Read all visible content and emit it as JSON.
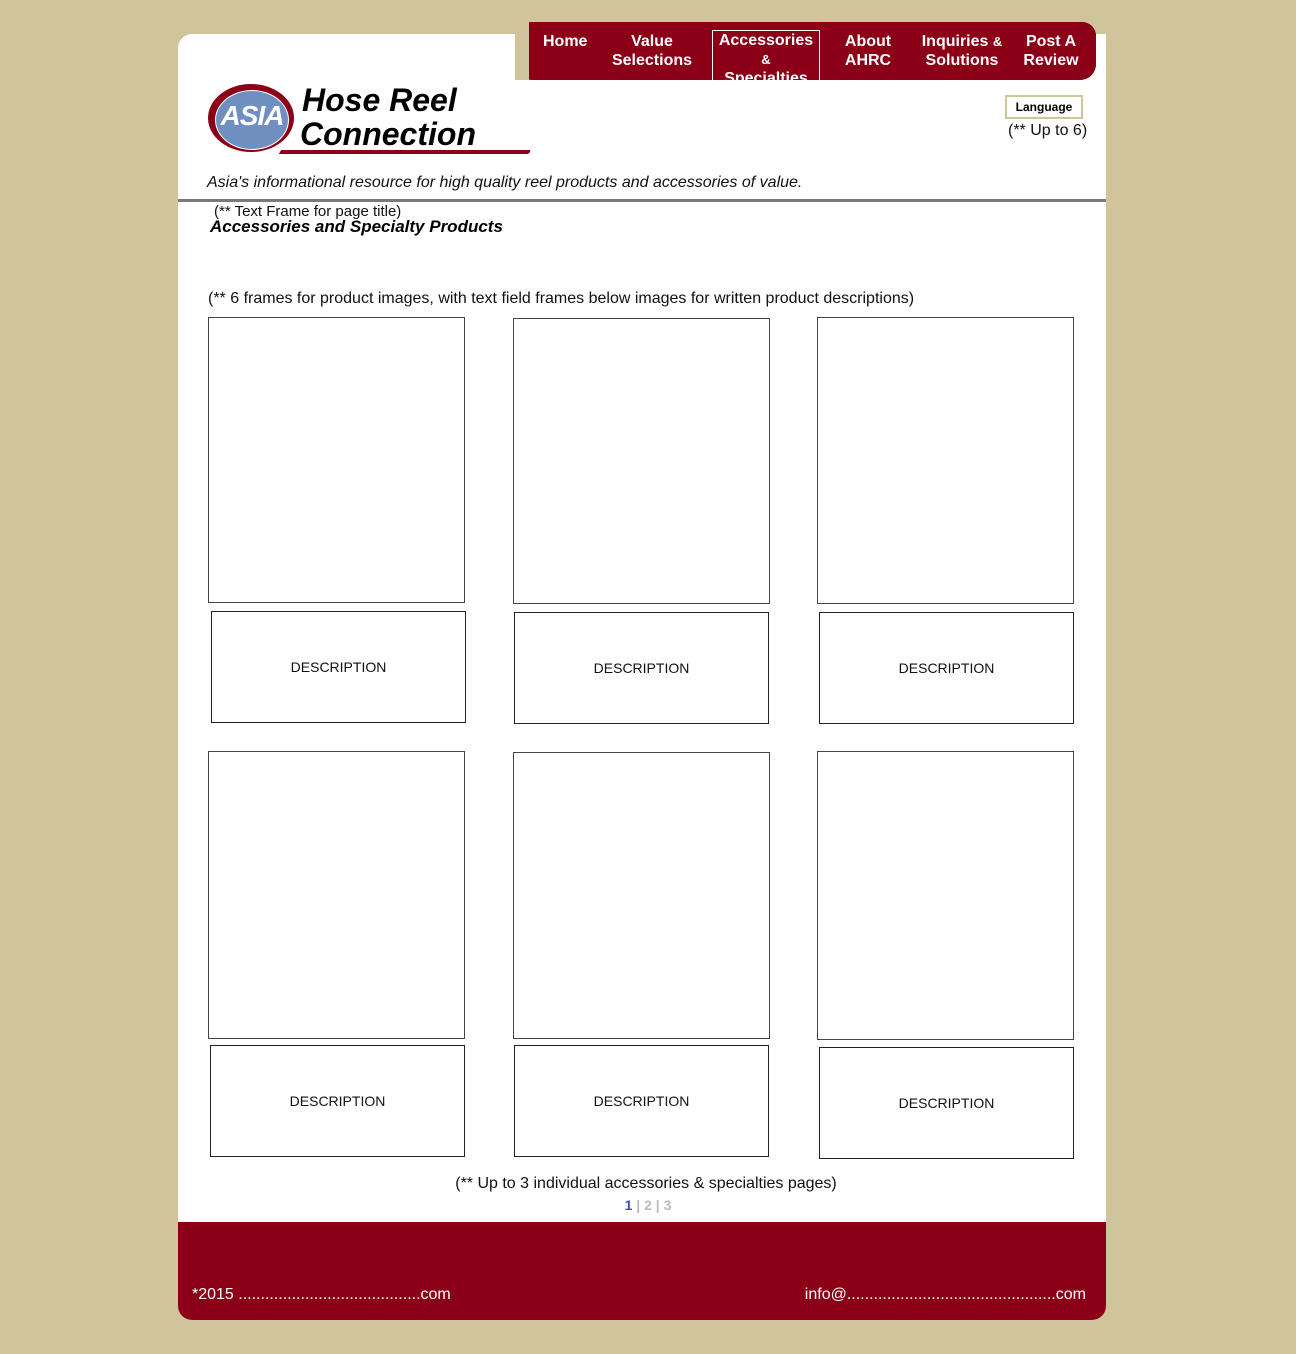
{
  "nav": {
    "items": [
      {
        "line1": "Home",
        "line2": ""
      },
      {
        "line1": "Value",
        "line2": "Selections"
      },
      {
        "line1": "Accessories",
        "line2_amp": "&",
        "line2": "Specialties"
      },
      {
        "line1": "About",
        "line2": "AHRC"
      },
      {
        "line1": "Inquiries",
        "line1_amp": "&",
        "line2": "Solutions"
      },
      {
        "line1": "Post A",
        "line2": "Review"
      }
    ],
    "active_index": 2
  },
  "logo": {
    "badge": "ASIA",
    "line1": "Hose Reel",
    "line2": "Connection"
  },
  "tagline": "Asia's informational resource for high quality reel products and accessories of value.",
  "language": {
    "button": "Language",
    "note": "(** Up to 6)"
  },
  "title_note": "(** Text Frame for page title)",
  "page_title": "Accessories and Specialty Products",
  "frames_note": "(** 6 frames for product images, with text field frames below images for written product descriptions)",
  "products": [
    {
      "description": "DESCRIPTION"
    },
    {
      "description": "DESCRIPTION"
    },
    {
      "description": "DESCRIPTION"
    },
    {
      "description": "DESCRIPTION"
    },
    {
      "description": "DESCRIPTION"
    },
    {
      "description": "DESCRIPTION"
    }
  ],
  "pages_note": "(** Up to 3 individual accessories & specialties pages)",
  "pager": {
    "pages": [
      "1",
      "2",
      "3"
    ],
    "separator": "|",
    "current": "1"
  },
  "footer": {
    "copyright": "*2015 .........................................com",
    "email": "info@...............................................com"
  },
  "colors": {
    "background": "#cfc49a",
    "brand": "#8b0016",
    "logo_badge": "#6f8fc0",
    "pager_current": "#3a4fc0"
  }
}
